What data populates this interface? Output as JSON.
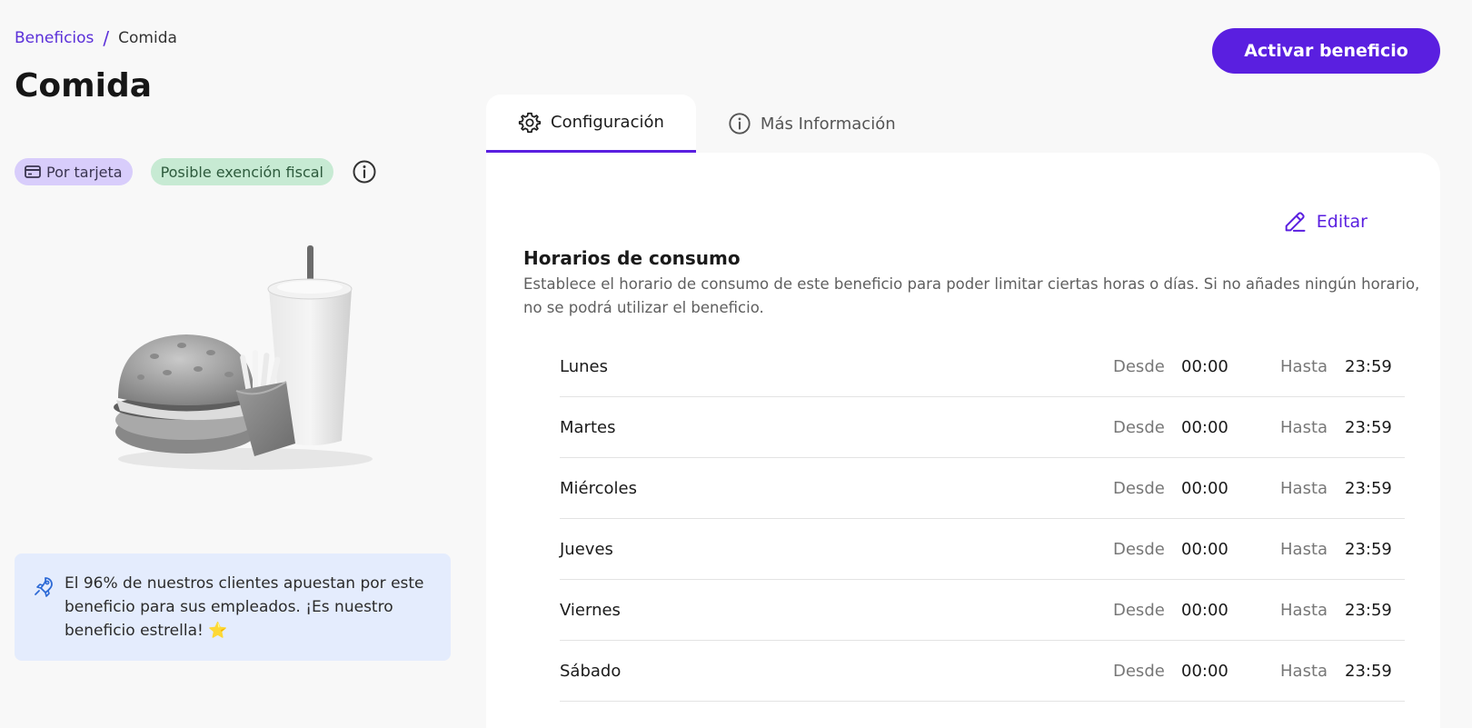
{
  "breadcrumb": {
    "parent": "Beneficios",
    "separator": "/",
    "current": "Comida"
  },
  "page_title": "Comida",
  "actions": {
    "activate_label": "Activar beneficio"
  },
  "tags": [
    {
      "label": "Por tarjeta",
      "icon": "credit-card-icon"
    },
    {
      "label": "Posible exención fiscal"
    }
  ],
  "tip": {
    "text": "El 96% de nuestros clientes apuestan por este beneficio para sus empleados. ¡Es nuestro beneficio estrella! ⭐",
    "icon": "rocket-icon"
  },
  "tabs": [
    {
      "label": "Configuración",
      "icon": "gear-icon",
      "active": true
    },
    {
      "label": "Más Información",
      "icon": "info-icon",
      "active": false
    }
  ],
  "config": {
    "edit_label": "Editar",
    "section_title": "Horarios de consumo",
    "section_description": "Establece el horario de consumo de este beneficio para poder limitar ciertas horas o días. Si no añades ningún horario, no se podrá utilizar el beneficio.",
    "from_label": "Desde",
    "to_label": "Hasta",
    "schedule": [
      {
        "day": "Lunes",
        "from": "00:00",
        "to": "23:59"
      },
      {
        "day": "Martes",
        "from": "00:00",
        "to": "23:59"
      },
      {
        "day": "Miércoles",
        "from": "00:00",
        "to": "23:59"
      },
      {
        "day": "Jueves",
        "from": "00:00",
        "to": "23:59"
      },
      {
        "day": "Viernes",
        "from": "00:00",
        "to": "23:59"
      },
      {
        "day": "Sábado",
        "from": "00:00",
        "to": "23:59"
      }
    ]
  },
  "colors": {
    "accent": "#5a1fe0",
    "tag_card_bg": "#d8cdfb",
    "tag_fiscal_bg": "#c7ead3",
    "tip_bg": "#e4ecfd"
  }
}
